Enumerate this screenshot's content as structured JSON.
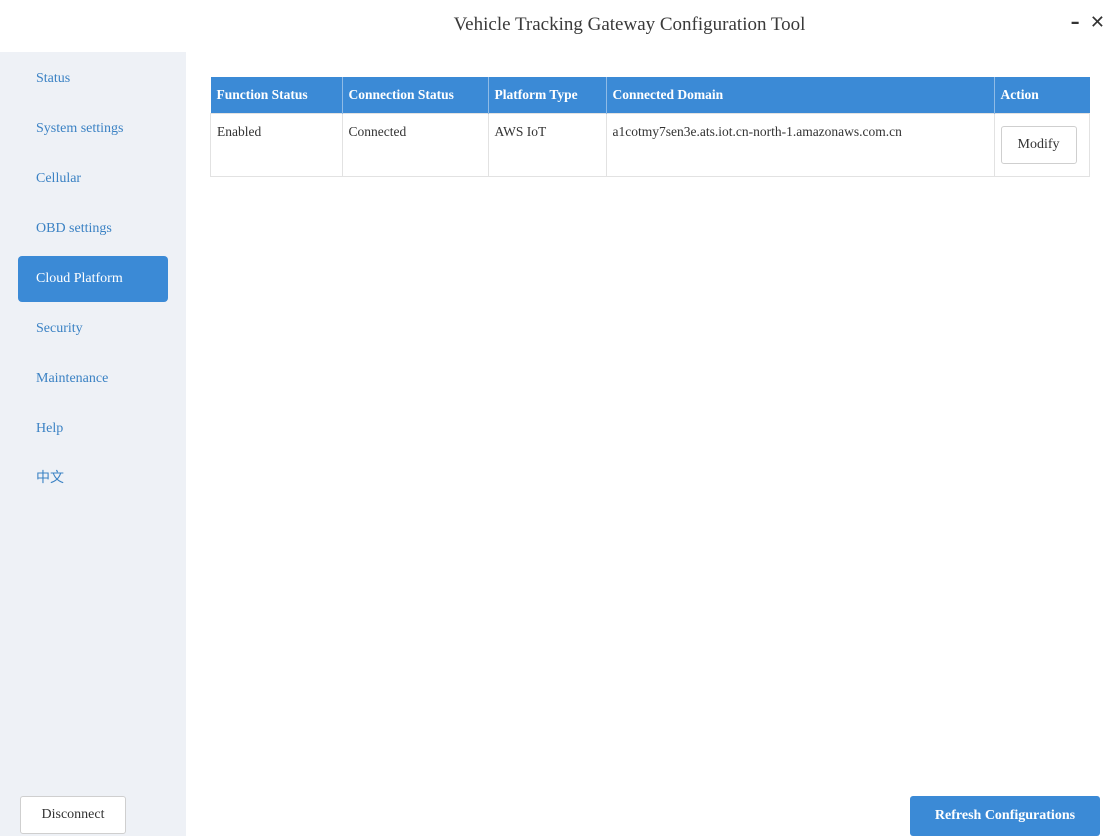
{
  "window": {
    "title": "Vehicle Tracking Gateway Configuration Tool",
    "minimize_label": "–",
    "close_label": "✕"
  },
  "sidebar": {
    "items": [
      {
        "label": "Status"
      },
      {
        "label": "System settings"
      },
      {
        "label": "Cellular"
      },
      {
        "label": "OBD settings"
      },
      {
        "label": "Cloud Platform",
        "active": true
      },
      {
        "label": "Security"
      },
      {
        "label": "Maintenance"
      },
      {
        "label": "Help"
      },
      {
        "label": "中文"
      }
    ],
    "disconnect_label": "Disconnect"
  },
  "table": {
    "headers": [
      "Function Status",
      "Connection Status",
      "Platform Type",
      "Connected Domain",
      "Action"
    ],
    "rows": [
      {
        "function_status": "Enabled",
        "connection_status": "Connected",
        "platform_type": "AWS IoT",
        "connected_domain": "a1cotmy7sen3e.ats.iot.cn-north-1.amazonaws.com.cn",
        "action_label": "Modify"
      }
    ]
  },
  "footer": {
    "refresh_label": "Refresh Configurations"
  },
  "colors": {
    "accent": "#3b8ad6",
    "sidebar_bg": "#eef1f6",
    "nav_text": "#3b82c4"
  }
}
